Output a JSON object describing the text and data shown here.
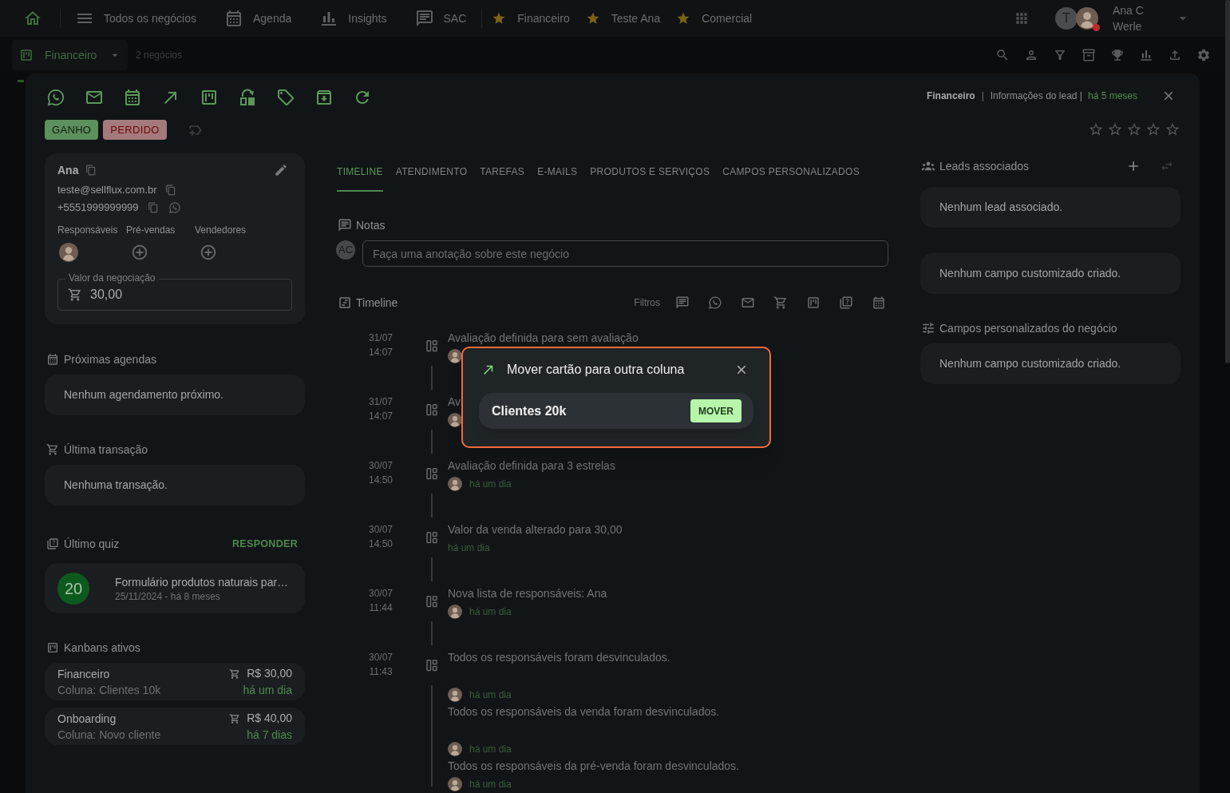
{
  "top_nav": {
    "items": [
      {
        "kind": "home",
        "selected": true
      },
      {
        "kind": "list",
        "label": "Todos os negócios",
        "selected": false
      },
      {
        "kind": "calendar",
        "label": "Agenda",
        "selected": false
      },
      {
        "kind": "chart",
        "label": "Insights",
        "selected": false
      },
      {
        "kind": "chat",
        "label": "SAC",
        "selected": false
      }
    ],
    "favorites": [
      {
        "label": "Financeiro"
      },
      {
        "label": "Teste Ana"
      },
      {
        "label": "Comercial"
      }
    ],
    "user": {
      "initial": "T",
      "name": "Ana C Werle",
      "notification": true
    }
  },
  "board_bar": {
    "board": "Financeiro",
    "count": "2 negócios",
    "tools": [
      {
        "kind": "search"
      },
      {
        "kind": "person"
      },
      {
        "kind": "filter"
      },
      {
        "kind": "archive"
      },
      {
        "kind": "trophy"
      },
      {
        "kind": "chart"
      },
      {
        "kind": "upload"
      },
      {
        "kind": "settings"
      }
    ]
  },
  "deal": {
    "actions": [
      {
        "kind": "whatsapp"
      },
      {
        "kind": "email"
      },
      {
        "kind": "calendar"
      },
      {
        "kind": "move"
      },
      {
        "kind": "kanban"
      },
      {
        "kind": "swap"
      },
      {
        "kind": "tag"
      },
      {
        "kind": "download"
      },
      {
        "kind": "refresh"
      }
    ],
    "outcome_buttons": [
      {
        "kind": "won",
        "label": "GANHO"
      },
      {
        "kind": "lost",
        "label": "PERDIDO"
      }
    ],
    "breadcrumb": {
      "board": "Financeiro",
      "separator": "|",
      "section": "Informações do lead |",
      "age": "há 5 meses"
    },
    "rating": {
      "stars": 0
    },
    "contact": {
      "name": "Ana",
      "email": "teste@sellflux.com.br",
      "phone": "+5551999999999",
      "roles": [
        {
          "label": "Responsáveis",
          "assigned": true
        },
        {
          "label": "Pré-vendas",
          "assigned": false
        },
        {
          "label": "Vendedores",
          "assigned": false
        }
      ],
      "value_field": {
        "label": "Valor da negociação",
        "value": "30,00"
      }
    },
    "upcoming": {
      "title": "Próximas agendas",
      "empty": "Nenhum agendamento próximo."
    },
    "last_transaction": {
      "title": "Última transação",
      "empty": "Nenhuma transação."
    },
    "last_quiz": {
      "title": "Último quiz",
      "action": "RESPONDER",
      "score": "20",
      "name": "Formulário produtos naturais par…",
      "date": "25/11/2024 - há 8 meses"
    },
    "kanbans": {
      "title": "Kanbans ativos",
      "items": [
        {
          "board": "Financeiro",
          "column": "Coluna: Clientes 10k",
          "value": "R$ 30,00",
          "time": "há um dia"
        },
        {
          "board": "Onboarding",
          "column": "Coluna: Novo cliente",
          "value": "R$ 40,00",
          "time": "há 7 dias"
        }
      ]
    },
    "tabs": [
      {
        "label": "TIMELINE",
        "selected": true
      },
      {
        "label": "ATENDIMENTO",
        "selected": false
      },
      {
        "label": "TAREFAS",
        "selected": false
      },
      {
        "label": "E-MAILS",
        "selected": false
      },
      {
        "label": "PRODUTOS E SERVIÇOS",
        "selected": false
      },
      {
        "label": "CAMPOS PERSONALIZADOS",
        "selected": false
      }
    ],
    "notes": {
      "title": "Notas",
      "initials": "AC",
      "placeholder": "Faça uma anotação sobre este negócio"
    },
    "timeline": {
      "title": "Timeline",
      "filter_label": "Filtros",
      "filters": [
        {
          "kind": "chat"
        },
        {
          "kind": "whatsapp"
        },
        {
          "kind": "email"
        },
        {
          "kind": "cart"
        },
        {
          "kind": "kanban"
        },
        {
          "kind": "quiz"
        },
        {
          "kind": "calendar"
        }
      ],
      "entries": [
        {
          "date": "31/07",
          "time": "14:07",
          "lines": [
            {
              "kind": "message",
              "text": "Avaliação definida para sem avaliação"
            },
            {
              "kind": "meta",
              "avatar": true
            }
          ]
        },
        {
          "date": "31/07",
          "time": "14:07",
          "lines": [
            {
              "kind": "message",
              "text": "Av"
            },
            {
              "kind": "meta",
              "avatar": true
            }
          ]
        },
        {
          "date": "30/07",
          "time": "14:50",
          "lines": [
            {
              "kind": "message",
              "text": "Avaliação definida para 3 estrelas"
            },
            {
              "kind": "meta",
              "avatar": true,
              "time": "há um dia"
            }
          ]
        },
        {
          "date": "30/07",
          "time": "14:50",
          "lines": [
            {
              "kind": "message",
              "text": "Valor da venda alterado para 30,00"
            },
            {
              "kind": "meta",
              "avatar": false,
              "time": "há um dia"
            }
          ]
        },
        {
          "date": "30/07",
          "time": "11:44",
          "lines": [
            {
              "kind": "message",
              "text": "Nova lista de responsáveis: Ana"
            },
            {
              "kind": "meta",
              "avatar": true,
              "time": "há um dia"
            }
          ]
        },
        {
          "date": "30/07",
          "time": "11:43",
          "lines": [
            {
              "kind": "message",
              "text": "Todos os responsáveis foram desvinculados."
            },
            {
              "kind": "meta",
              "avatar": true,
              "time": "há um dia"
            },
            {
              "kind": "message",
              "text": "Todos os responsáveis da venda foram desvinculados."
            },
            {
              "kind": "meta",
              "avatar": true,
              "time": "há um dia"
            },
            {
              "kind": "message",
              "text": "Todos os responsáveis da pré-venda foram desvinculados."
            },
            {
              "kind": "meta",
              "avatar": true,
              "time": "há um dia"
            }
          ]
        }
      ]
    },
    "associated_leads": {
      "title": "Leads associados",
      "empty": "Nenhum lead associado."
    },
    "lead_custom_fields": {
      "empty": "Nenhum campo customizado criado."
    },
    "deal_custom_fields": {
      "title": "Campos personalizados do negócio",
      "empty": "Nenhum campo customizado criado."
    }
  },
  "move_dialog": {
    "title": "Mover cartão para outra coluna",
    "column": "Clientes 20k",
    "button": "MOVER"
  }
}
